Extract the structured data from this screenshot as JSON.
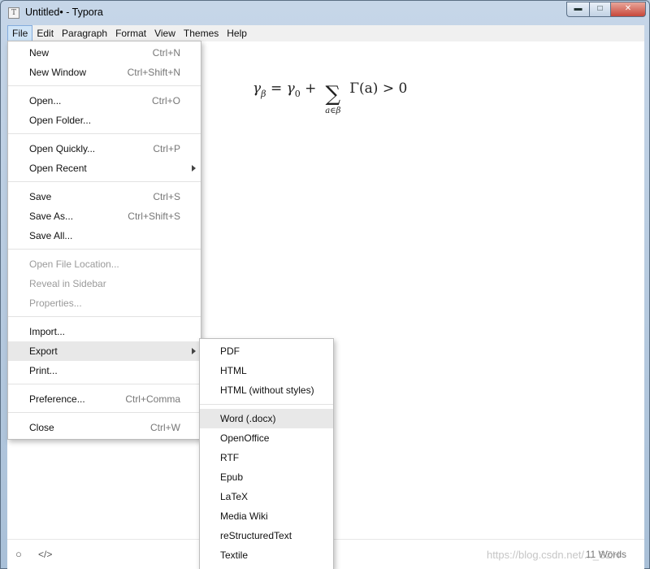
{
  "window": {
    "title": "Untitled• - Typora",
    "app_icon": "T",
    "minimize_glyph": "▬",
    "maximize_glyph": "□",
    "close_glyph": "✕"
  },
  "menubar": [
    "File",
    "Edit",
    "Paragraph",
    "Format",
    "View",
    "Themes",
    "Help"
  ],
  "editor": {
    "formula": {
      "lhs": "γ",
      "lhs_sub": "β",
      "eq": "=",
      "term1": "γ",
      "term1_sub": "0",
      "plus": "+",
      "sum_symbol": "∑",
      "sum_sub": "a∈β",
      "body": "Γ(a) > 0"
    }
  },
  "file_menu": {
    "items": [
      {
        "label": "New",
        "shortcut": "Ctrl+N"
      },
      {
        "label": "New Window",
        "shortcut": "Ctrl+Shift+N"
      },
      {
        "label": "Open...",
        "shortcut": "Ctrl+O"
      },
      {
        "label": "Open Folder...",
        "shortcut": ""
      },
      {
        "label": "Open Quickly...",
        "shortcut": "Ctrl+P"
      },
      {
        "label": "Open Recent",
        "shortcut": ""
      },
      {
        "label": "Save",
        "shortcut": "Ctrl+S"
      },
      {
        "label": "Save As...",
        "shortcut": "Ctrl+Shift+S"
      },
      {
        "label": "Save All...",
        "shortcut": ""
      },
      {
        "label": "Open File Location...",
        "shortcut": ""
      },
      {
        "label": "Reveal in Sidebar",
        "shortcut": ""
      },
      {
        "label": "Properties...",
        "shortcut": ""
      },
      {
        "label": "Import...",
        "shortcut": ""
      },
      {
        "label": "Export",
        "shortcut": ""
      },
      {
        "label": "Print...",
        "shortcut": ""
      },
      {
        "label": "Preference...",
        "shortcut": "Ctrl+Comma"
      },
      {
        "label": "Close",
        "shortcut": "Ctrl+W"
      }
    ]
  },
  "export_menu": {
    "items": [
      "PDF",
      "HTML",
      "HTML (without styles)",
      "Word (.docx)",
      "OpenOffice",
      "RTF",
      "Epub",
      "LaTeX",
      "Media Wiki",
      "reStructuredText",
      "Textile"
    ]
  },
  "statusbar": {
    "circle_icon": "○",
    "code_icon": "</>",
    "word_count": "11 Words",
    "watermark": "https://blog.csdn.net/..._SZH"
  }
}
